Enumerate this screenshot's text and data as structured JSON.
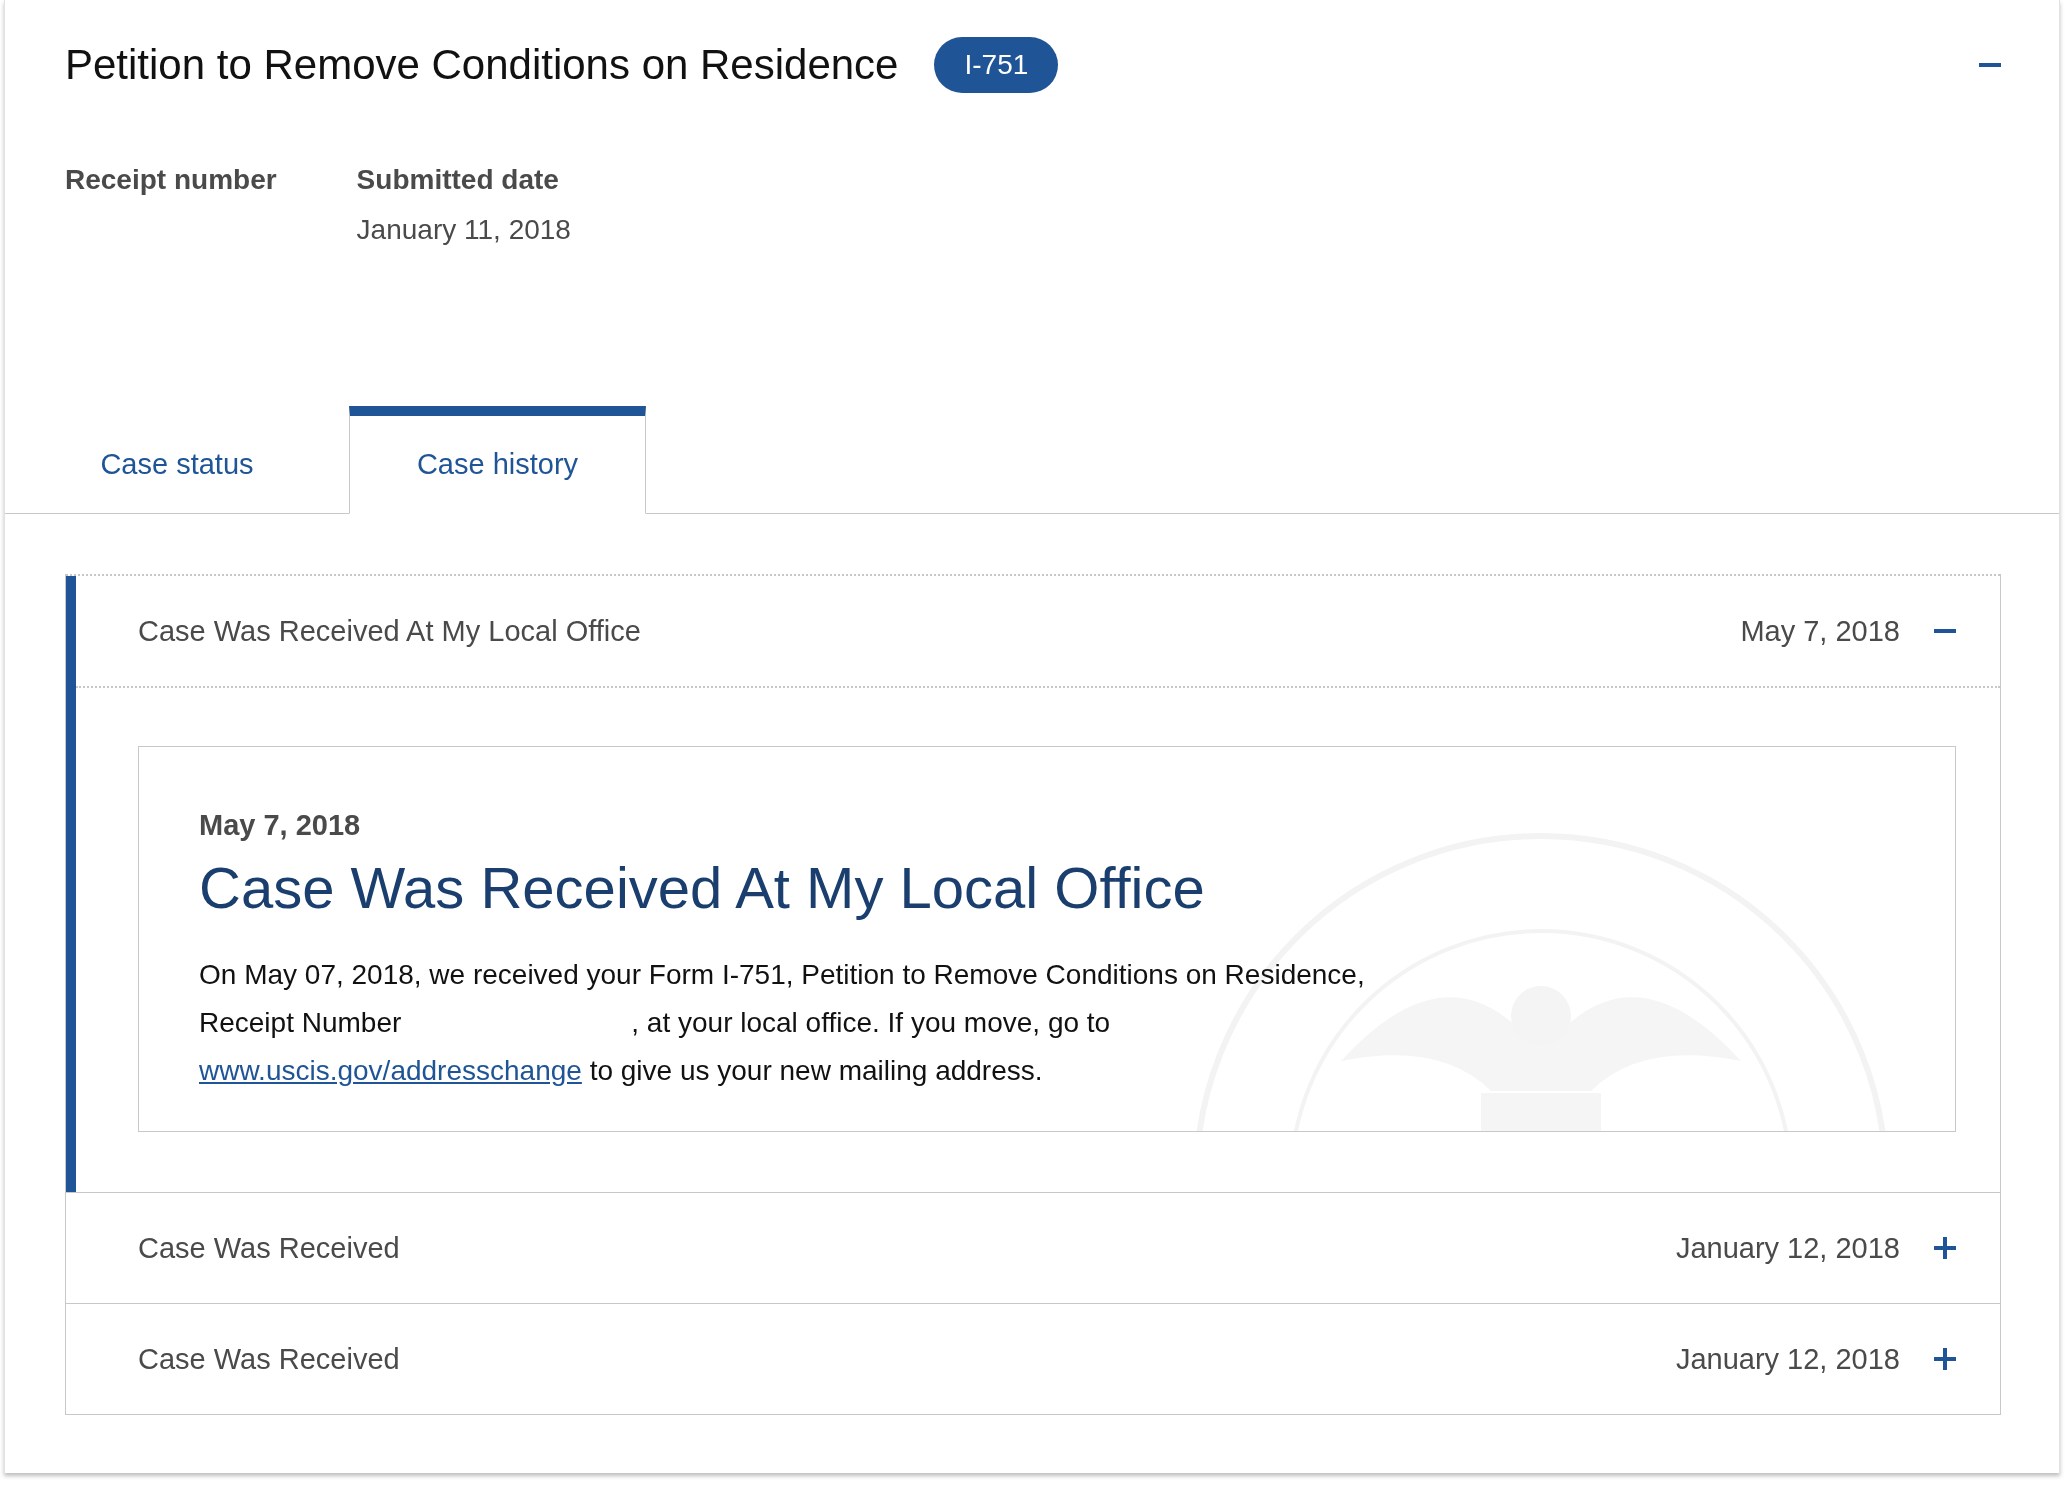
{
  "form": {
    "title": "Petition to Remove Conditions on Residence",
    "badge": "I-751",
    "expanded": true
  },
  "fields": [
    {
      "label": "Receipt number"
    },
    {
      "label": "Submitted date",
      "value": "January 11, 2018"
    }
  ],
  "tabs": [
    {
      "label": "Case status",
      "selected": false
    },
    {
      "label": "Case history",
      "selected": true
    }
  ],
  "history": [
    {
      "title": "Case Was Received At My Local Office",
      "date": "May 7, 2018",
      "expanded": true,
      "detail": {
        "date": "May 7, 2018",
        "heading": "Case Was Received At My Local Office",
        "text_before": "On May 07, 2018, we received your Form I-751, Petition to Remove Conditions on Residence, Receipt Number",
        "text_after": ", at your local office. If you move, go to",
        "link": "www.uscis.gov/addresschange",
        "text_end": "to give us your new mailing address."
      }
    },
    {
      "title": "Case Was Received",
      "date": "January 12, 2018",
      "expanded": false
    },
    {
      "title": "Case Was Received",
      "date": "January 12, 2018",
      "expanded": false
    }
  ]
}
